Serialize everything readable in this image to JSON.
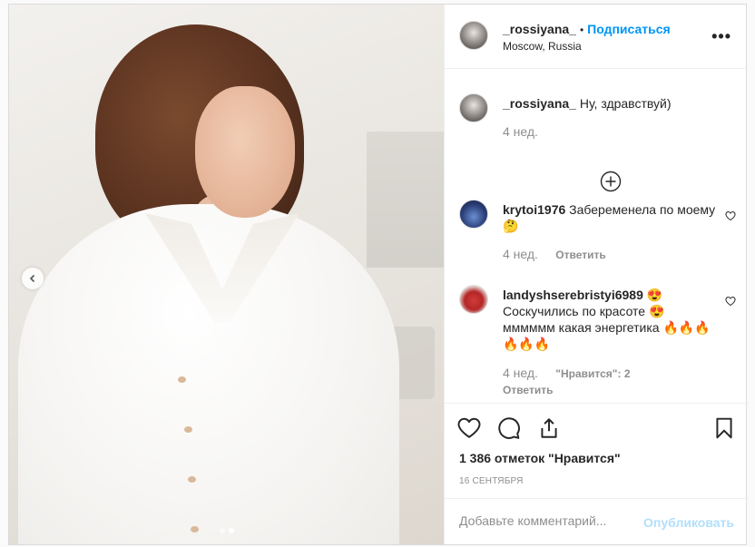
{
  "header": {
    "username": "_rossiyana_",
    "separator": "•",
    "follow_label": "Подписаться",
    "location": "Moscow, Russia",
    "more_label": "•••"
  },
  "caption": {
    "username": "_rossiyana_",
    "text": "Ну, здравствуй)",
    "time": "4 нед."
  },
  "comments": [
    {
      "username": "krytoi1976",
      "text": "Забеременела по моему🤔",
      "time": "4 нед.",
      "reply_label": "Ответить"
    },
    {
      "username": "landyshserebristyi6989",
      "text": "😍 Соскучились по красоте 😍 мммммм какая энергетика 🔥🔥🔥🔥🔥🔥",
      "time": "4 нед.",
      "likes_label": "\"Нравится\": 2",
      "reply_label": "Ответить"
    }
  ],
  "actions": {
    "likes": "1 386 отметок \"Нравится\"",
    "date": "16 СЕНТЯБРЯ"
  },
  "add_comment": {
    "placeholder": "Добавьте комментарий...",
    "publish_label": "Опубликовать"
  },
  "colors": {
    "accent": "#0095f6",
    "publish_disabled": "#b2dffc",
    "muted": "#8e8e8e"
  },
  "icons": [
    "heart-icon",
    "comment-icon",
    "share-icon",
    "bookmark-icon",
    "plus-circle-icon",
    "chevron-left-icon",
    "more-icon"
  ]
}
